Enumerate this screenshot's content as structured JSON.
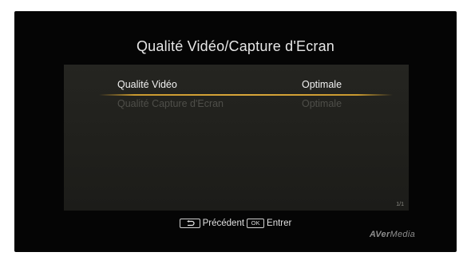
{
  "screen": {
    "title": "Qualité Vidéo/Capture d'Ecran"
  },
  "menu": {
    "items": [
      {
        "label": "Qualité Vidéo",
        "value": "Optimale",
        "state": "selected"
      },
      {
        "label": "Qualité Capture d'Ecran",
        "value": "Optimale",
        "state": "dim"
      }
    ],
    "page_indicator": "1/1",
    "highlight_color": "#d9a63a"
  },
  "footer": {
    "back_icon": "return-arrow-icon",
    "back_label": "Précédent",
    "ok_key": "OK",
    "enter_label": "Entrer"
  },
  "brand": {
    "logo_part1": "AVer",
    "logo_part2": "Media"
  }
}
